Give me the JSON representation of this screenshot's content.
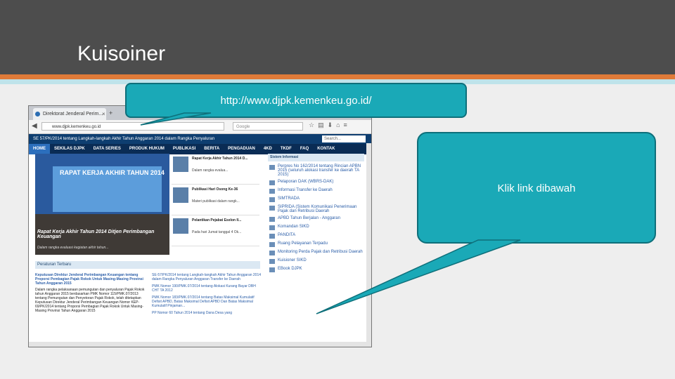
{
  "slide": {
    "title": "Kuisoiner",
    "callout_url": "http://www.djpk.kemenkeu.go.id/",
    "callout_hint": "Klik link dibawah"
  },
  "browser": {
    "tab_label": "Direktorat Jenderal Perim...",
    "tab_close": "×",
    "new_tab": "+",
    "url": "www.djpk.kemenkeu.go.id",
    "search_placeholder": "Google",
    "site_header": "SE 57/PK/2014 tentang Langkah-langkah Akhir Tahun Anggaran 2014 dalam Rangka Penyaluran",
    "site_search_placeholder": "Search...",
    "nav_items": [
      "HOME",
      "SEKILAS DJPK",
      "DATA SERIES",
      "PRODUK HUKUM",
      "PUBLIKASI",
      "BERITA",
      "PENGADUAN",
      "4KD",
      "TKDF",
      "FAQ",
      "KONTAK"
    ],
    "hero": {
      "banner_title": "RAPAT KERJA AKHIR TAHUN 2014",
      "caption": "Rapat Kerja Akhir Tahun 2014 Ditjen Perimbangan Keuangan",
      "subcaption": "Dalam rangka evaluasi kegiatan akhir tahun..."
    },
    "news": [
      {
        "title": "Rapat Kerja Akhir Tahun 2014 D...",
        "desc": "Dalam rangka evalua..."
      },
      {
        "title": "Publikasi Hari Osong Ke-36",
        "desc": "Materi publikasi dalam rangk..."
      },
      {
        "title": "Pelantikan Pejabat Eselon II...",
        "desc": "Pada hari Jumat tanggal 4 Ok..."
      }
    ],
    "info_head": "Sistem Informasi",
    "info_items": [
      "Perpres No 162/2014 tentang Rincian APBN 2015 (seluruh alokasi transfer ke daerah TA 2015)",
      "Pelaporan DAK (WBRS-DAK)",
      "Informasi Transfer ke Daerah",
      "SIMTRADA",
      "SIPRIDA (Sistem Komunikasi Penerimaan Pajak dan Retribusi Daerah",
      "APBD Tahun Berjalan - Anggaran",
      "Komandan SIKD",
      "PANDITA",
      "Ruang Pelayanan Terpadu",
      "Monitoring Perda Pajak dan Retribusi Daerah",
      "Kuisioner SIKD",
      "EBook DJPK"
    ],
    "peraturan_head": "Peraturan Terbaru",
    "per_left_title": "Keputusan Direktur Jenderal Perimbangan Keuangan tentang Proporsi Pembagian Pajak Rokok Untuk Masing-Masing Provinsi Tahun Anggaran 2015",
    "per_left_body": "Dalam rangka pelaksanaan pemungutan dan penyaluran Pajak Rokok tahun Anggaran 2015 berdasarkan PMK Nomor 115/PMK.07/2013 tentang Pemungutan dan Penyetoran Pajak Rokok, telah ditetapkan Keputusan Direktur Jenderal Perimbangan Keuangan Nomor KEP-69/PK/2014 tentang Proporsi Pembagian Pajak Rokok Untuk Masing-Masing Provinsi Tahun Anggaran 2015",
    "per_right": [
      "SE-57/PK/2014 tentang Langkah-langkah Akhir Tahun Anggaran 2014 dalam Rangka Penyaluran Anggaran Transfer ke Daerah",
      "PMK Nomor 190/PMK.07/2014 tentang Alokasi Kurang Bayar DBH CHT TA 2012",
      "PMK Nomor 183/PMK.07/2014 tentang Batas Maksimal Kumulatif Defisit APBD, Batas Maksimal Defisit APBD Dan Batas Maksimal Kumulatif Pinjaman...",
      "PP Nomor 60 Tahun 2014 tentang Dana Desa yang"
    ]
  }
}
